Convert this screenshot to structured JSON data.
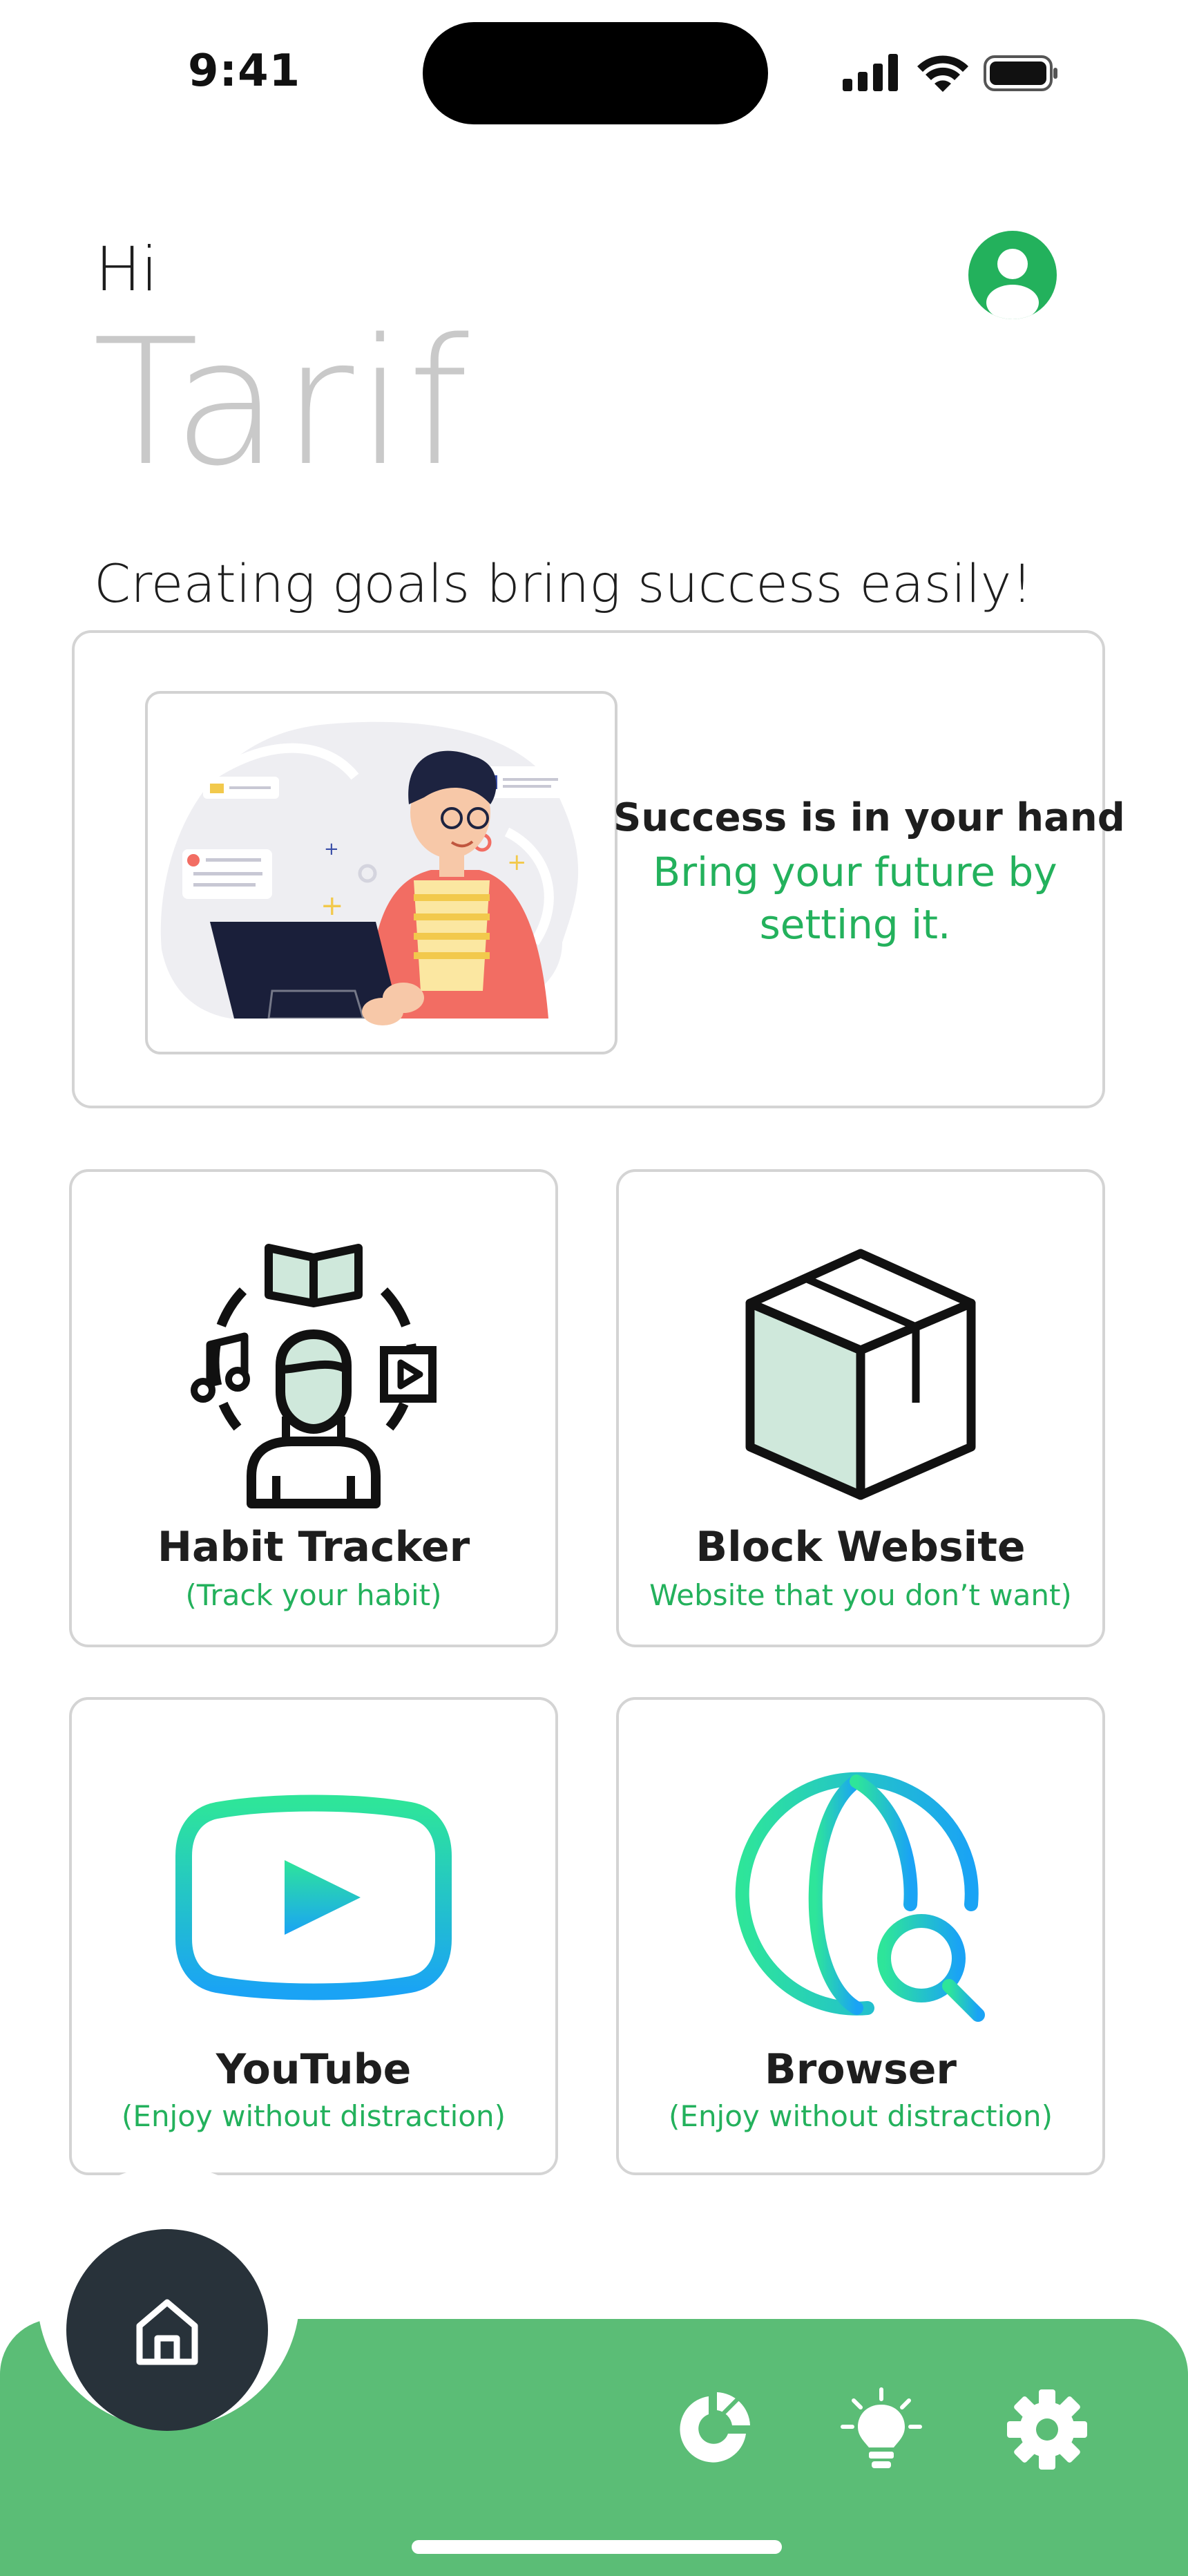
{
  "status_bar": {
    "time": "9:41",
    "icons": [
      "cellular-signal-icon",
      "wifi-icon",
      "battery-icon"
    ]
  },
  "greeting": {
    "hi": "Hi",
    "name": "Tarif",
    "tagline": "Creating goals bring success easily!"
  },
  "profile": {
    "icon": "user-icon"
  },
  "hero": {
    "title": "Success is in your hand",
    "subtitle": "Bring your future by setting it."
  },
  "cards": [
    {
      "title": "Habit Tracker",
      "subtitle": "(Track your habit)",
      "icon": "habit-person-icon"
    },
    {
      "title": "Block Website",
      "subtitle": "Website that you don’t want)",
      "icon": "box-icon"
    },
    {
      "title": "YouTube",
      "subtitle": "(Enjoy without distraction)",
      "icon": "youtube-play-icon"
    },
    {
      "title": "Browser",
      "subtitle": "(Enjoy without distraction)",
      "icon": "globe-search-icon"
    }
  ],
  "nav": {
    "items": [
      "home-icon",
      "pie-chart-icon",
      "lightbulb-icon",
      "gear-icon"
    ]
  },
  "colors": {
    "accent_green": "#23b15c",
    "nav_green": "#5bbd76",
    "home_button": "#28323a",
    "muted_name": "#c9c9c9",
    "card_border": "#d4d4d4"
  }
}
